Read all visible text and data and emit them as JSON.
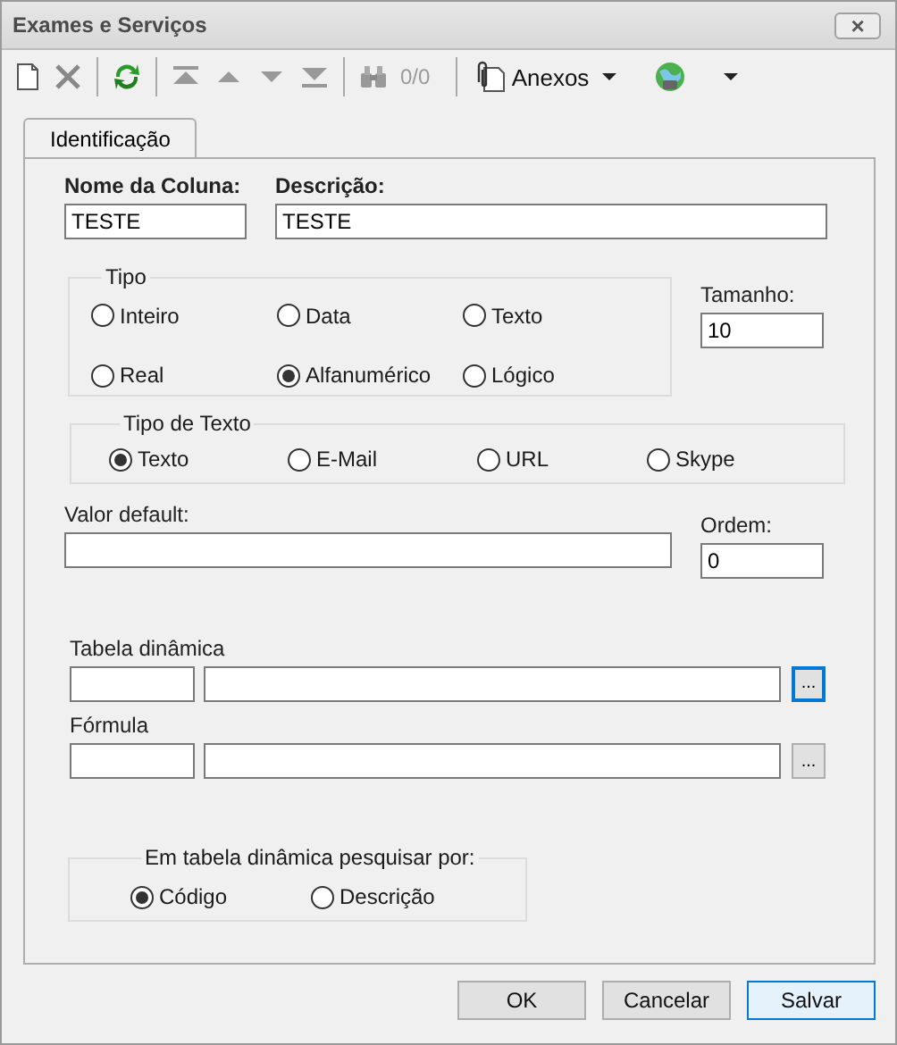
{
  "window": {
    "title": "Exames e Serviços",
    "close": "×"
  },
  "toolbar": {
    "counter": "0/0",
    "attachments": "Anexos"
  },
  "tabs": [
    {
      "label": "Identificação",
      "selected": true
    }
  ],
  "column_name": {
    "label": "Nome da Coluna:",
    "value": "TESTE"
  },
  "description": {
    "label": "Descrição:",
    "value": "TESTE"
  },
  "type_group": {
    "title": "Tipo",
    "options": [
      {
        "label": "Inteiro",
        "selected": false
      },
      {
        "label": "Data",
        "selected": false
      },
      {
        "label": "Texto",
        "selected": false
      },
      {
        "label": "Real",
        "selected": false
      },
      {
        "label": "Alfanumérico",
        "selected": true
      },
      {
        "label": "Lógico",
        "selected": false
      }
    ]
  },
  "size": {
    "label": "Tamanho:",
    "value": "10"
  },
  "text_type_group": {
    "title": "Tipo de Texto",
    "options": [
      {
        "label": "Texto",
        "selected": true
      },
      {
        "label": "E-Mail",
        "selected": false
      },
      {
        "label": "URL",
        "selected": false
      },
      {
        "label": "Skype",
        "selected": false
      }
    ]
  },
  "default_value": {
    "label": "Valor default:"
  },
  "order": {
    "label": "Ordem:",
    "value": "0"
  },
  "dynamic_table": {
    "label": "Tabela dinâmica",
    "button": "...",
    "focused": true
  },
  "formula": {
    "label": "Fórmula",
    "button": "...",
    "focused": false
  },
  "search_group": {
    "title": "Em tabela dinâmica pesquisar por:",
    "options": [
      {
        "label": "Código",
        "selected": true
      },
      {
        "label": "Descrição",
        "selected": false
      }
    ]
  },
  "buttons": [
    {
      "label": "OK",
      "focused": false
    },
    {
      "label": "Cancelar",
      "focused": false
    },
    {
      "label": "Salvar",
      "focused": true
    }
  ]
}
